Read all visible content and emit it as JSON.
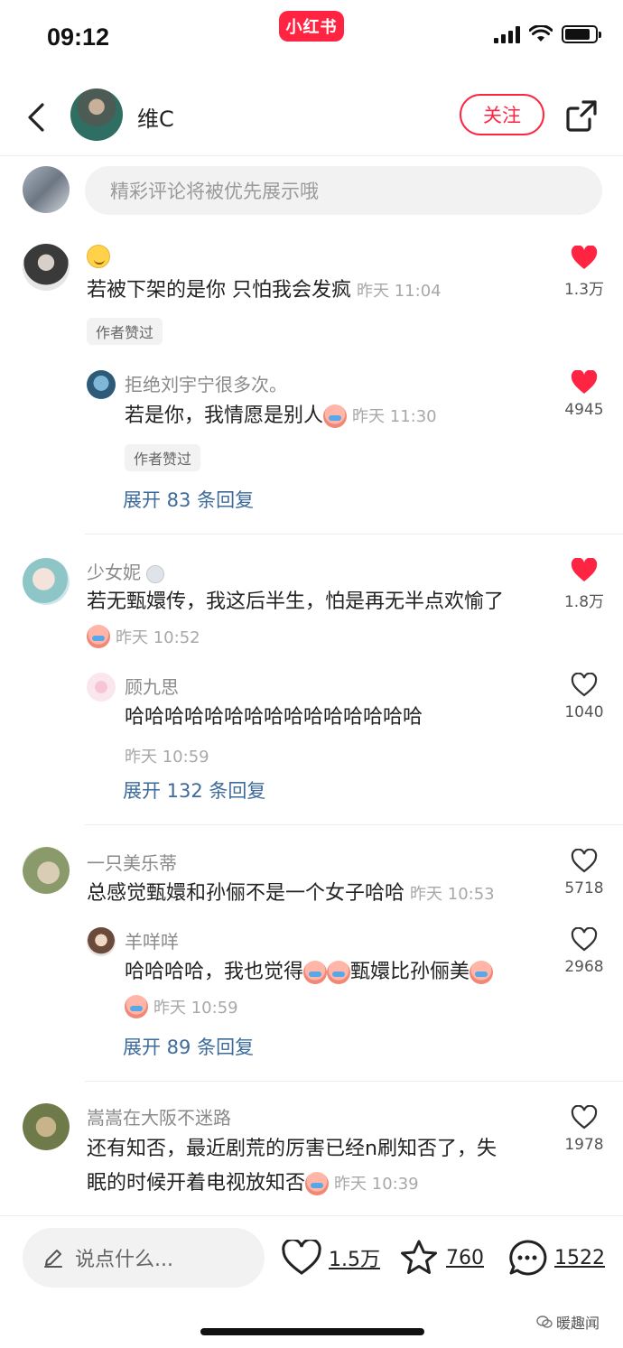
{
  "status_bar": {
    "time": "09:12",
    "app_badge": "小红书",
    "battery_level": 0.85
  },
  "header": {
    "author_name": "维C",
    "follow_label": "关注"
  },
  "comment_box": {
    "placeholder": "精彩评论将被优先展示哦"
  },
  "comments": [
    {
      "username": "",
      "text": "若被下架的是你 只怕我会发疯",
      "time": "昨天 11:04",
      "likes": "1.3万",
      "liked": true,
      "author_tag": "作者赞过",
      "reply": {
        "username": "拒绝刘宇宁很多次。",
        "text": "若是你，我情愿是别人",
        "time": "昨天 11:30",
        "likes": "4945",
        "liked": true,
        "author_tag": "作者赞过"
      },
      "expand_label": "展开 83 条回复"
    },
    {
      "username": "少女妮",
      "text": "若无甄嬛传，我这后半生，怕是再无半点欢愉了",
      "time": "昨天 10:52",
      "likes": "1.8万",
      "liked": true,
      "reply": {
        "username": "顾九思",
        "text": "哈哈哈哈哈哈哈哈哈哈哈哈哈哈哈",
        "time": "昨天 10:59",
        "likes": "1040",
        "liked": false
      },
      "expand_label": "展开 132 条回复"
    },
    {
      "username": "一只美乐蒂",
      "text": "总感觉甄嬛和孙俪不是一个女子哈哈",
      "time": "昨天 10:53",
      "likes": "5718",
      "liked": false,
      "reply": {
        "username": "羊咩咩",
        "text_a": "哈哈哈哈，我也觉得",
        "text_b": "甄嬛比孙俪美",
        "time": "昨天 10:59",
        "likes": "2968",
        "liked": false
      },
      "expand_label": "展开 89 条回复"
    },
    {
      "username": "嵩嵩在大阪不迷路",
      "text_line1": "还有知否，最近剧荒的厉害已经n刷知否了，失",
      "text_line2": "眠的时候开着电视放知否",
      "time": "昨天 10:39",
      "likes": "1978",
      "liked": false
    }
  ],
  "bottom_bar": {
    "input_placeholder": "说点什么...",
    "likes": "1.5万",
    "collects": "760",
    "comments": "1522"
  },
  "watermark": "暖趣闻",
  "colors": {
    "accent": "#ff2442",
    "link": "#3d6b9c",
    "muted": "#8a8a8a"
  }
}
